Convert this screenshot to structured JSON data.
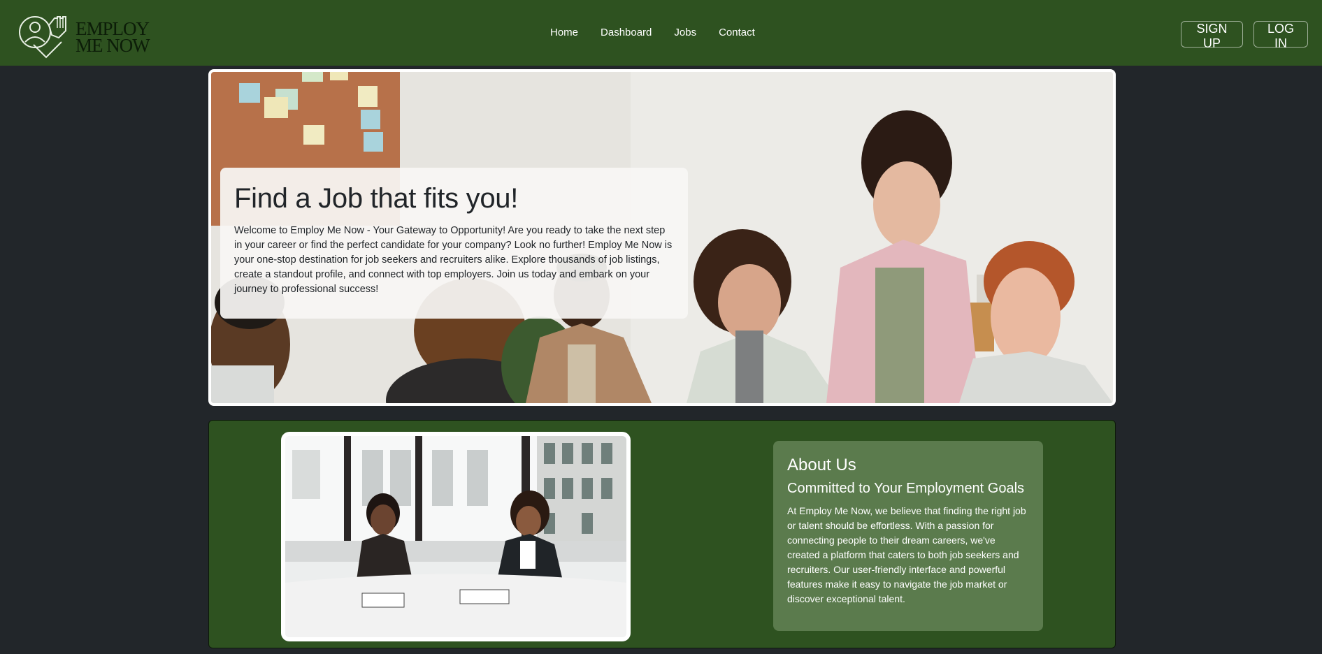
{
  "navbar": {
    "logo_line1": "EMPLOY",
    "logo_line2": "ME NOW",
    "links": [
      "Home",
      "Dashboard",
      "Jobs",
      "Contact"
    ],
    "signup_label": "SIGN UP",
    "login_label": "LOG IN"
  },
  "hero": {
    "title": "Find a Job that fits you!",
    "description": "Welcome to Employ Me Now - Your Gateway to Opportunity! Are you ready to take the next step in your career or find the perfect candidate for your company? Look no further! Employ Me Now is your one-stop destination for job seekers and recruiters alike. Explore thousands of job listings, create a standout profile, and connect with top employers. Join us today and embark on your journey to professional success!"
  },
  "about": {
    "heading": "About Us",
    "subheading": "Committed to Your Employment Goals",
    "body": "At Employ Me Now, we believe that finding the right job or talent should be effortless. With a passion for connecting people to their dream careers, we've created a platform that caters to both job seekers and recruiters. Our user-friendly interface and powerful features make it easy to navigate the job market or discover exceptional talent."
  },
  "colors": {
    "navbar": "#2e5220",
    "page_background": "#22262a",
    "about_card": "#5b7b4d"
  },
  "icons": [
    "logo-handshake-icon"
  ]
}
